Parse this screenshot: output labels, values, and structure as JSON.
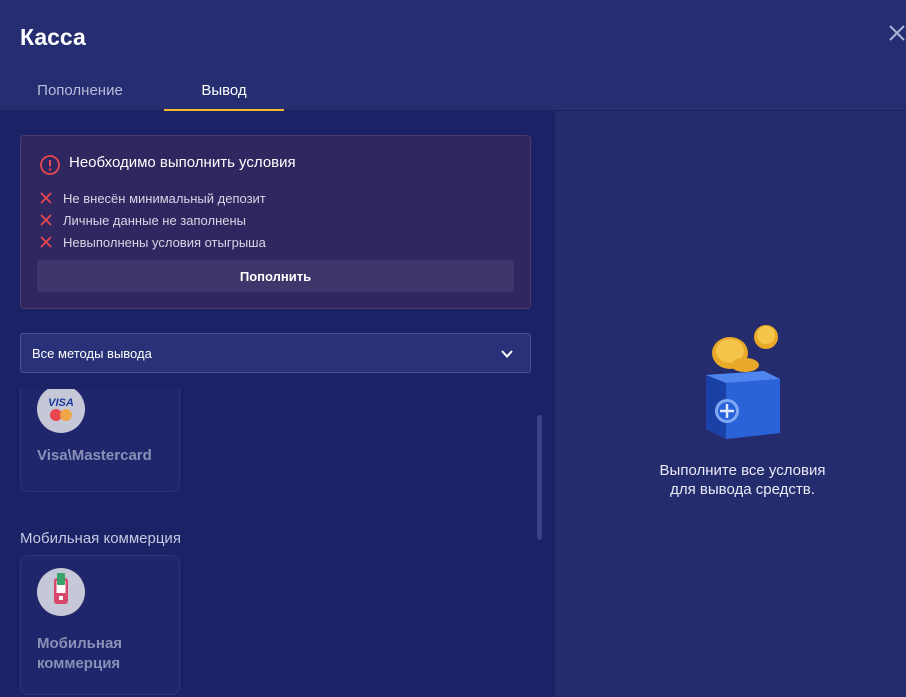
{
  "header": {
    "title": "Касса",
    "tabs": [
      {
        "label": "Пополнение",
        "active": false
      },
      {
        "label": "Вывод",
        "active": true
      }
    ],
    "close_icon": "close-icon"
  },
  "alert": {
    "icon": "alert-circle-icon",
    "title": "Необходимо выполнить условия",
    "conditions": [
      "Не внесён минимальный депозит",
      "Личные данные не заполнены",
      "Невыполнены условия отыгрыша"
    ],
    "button_label": "Пополнить"
  },
  "filter": {
    "selected": "Все методы вывода",
    "icon": "chevron-down-icon"
  },
  "methods": {
    "visa_label": "Visa\\Mastercard",
    "mobile_section_title": "Мобильная коммерция",
    "mobile_label": "Мобильная коммерция",
    "visa_logo_text": "VISA"
  },
  "info_panel": {
    "message_line1": "Выполните все условия",
    "message_line2": "для вывода средств."
  },
  "colors": {
    "accent": "#f2b830",
    "error": "#e8474f",
    "background": "#1d2466"
  }
}
